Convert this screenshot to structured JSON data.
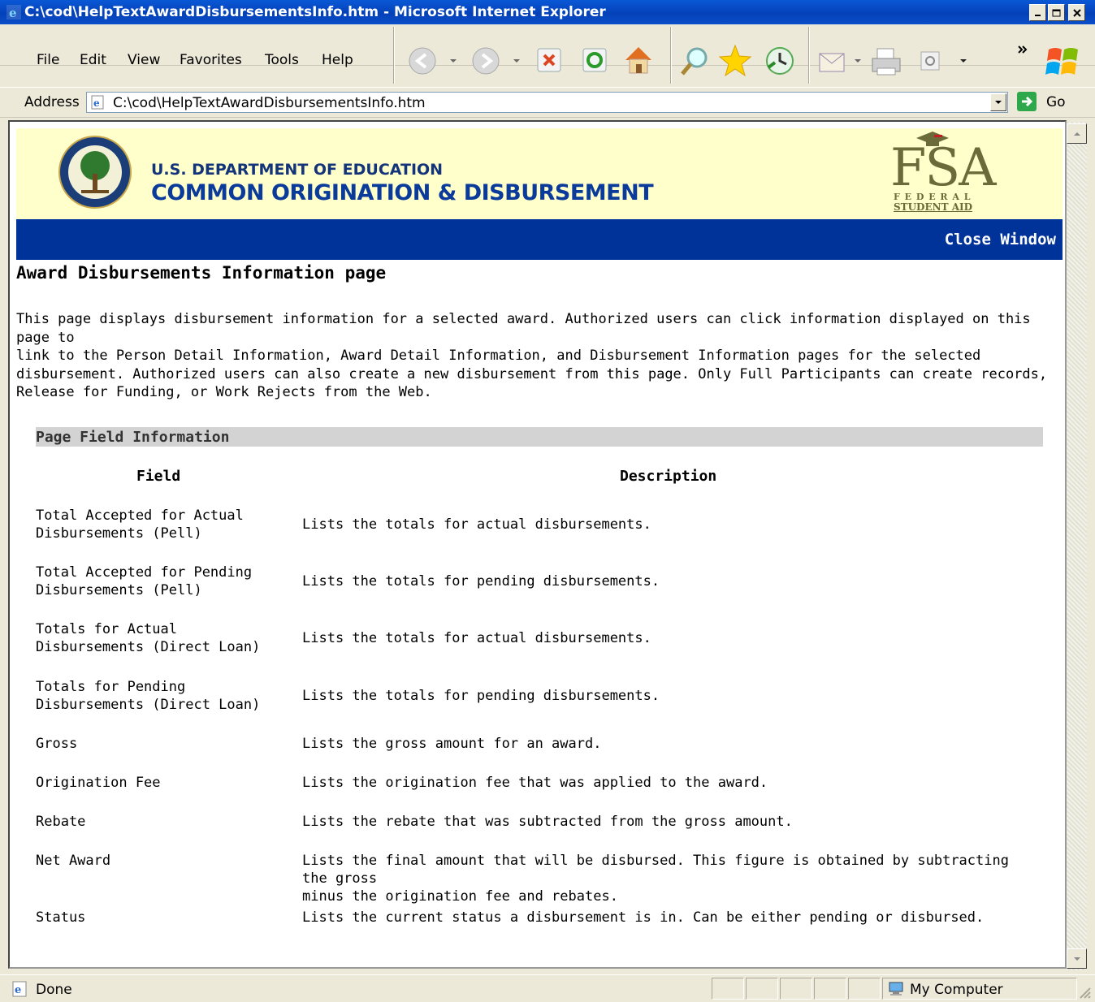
{
  "window": {
    "title": "C:\\cod\\HelpTextAwardDisbursementsInfo.htm - Microsoft Internet Explorer"
  },
  "menu": [
    "File",
    "Edit",
    "View",
    "Favorites",
    "Tools",
    "Help"
  ],
  "address": {
    "label": "Address",
    "url": "C:\\cod\\HelpTextAwardDisbursementsInfo.htm",
    "go_label": "Go"
  },
  "header": {
    "dept": "U.S. DEPARTMENT OF EDUCATION",
    "system": "COMMON ORIGINATION & DISBURSEMENT",
    "fsa_logo_text": "FSA",
    "fsa_logo_sub1": "F E D E R A L",
    "fsa_logo_sub2": "STUDENT AID"
  },
  "nav": {
    "close_window": "Close Window"
  },
  "page": {
    "title": "Award Disbursements Information page",
    "intro_lines": [
      "This page displays disbursement information for a selected award. Authorized users can click information displayed on this page to",
      "link to the Person Detail Information, Award Detail Information, and Disbursement Information pages for the selected",
      "disbursement. Authorized users can also create a new disbursement from this page. Only Full Participants can create records,",
      "Release for Funding, or Work Rejects from the Web."
    ],
    "section_title": "Page Field Information",
    "col_field": "Field",
    "col_description": "Description",
    "rows": [
      {
        "field": [
          "Total Accepted for Actual",
          "Disbursements (Pell)"
        ],
        "description": [
          "Lists the totals for actual disbursements."
        ]
      },
      {
        "field": [
          "Total Accepted for Pending",
          "Disbursements (Pell)"
        ],
        "description": [
          "Lists the totals for pending disbursements."
        ]
      },
      {
        "field": [
          "Totals for Actual",
          "Disbursements (Direct Loan)"
        ],
        "description": [
          "Lists the totals for actual disbursements."
        ]
      },
      {
        "field": [
          "Totals for Pending",
          "Disbursements (Direct Loan)"
        ],
        "description": [
          "Lists the totals for pending disbursements."
        ]
      },
      {
        "field": [
          "Gross"
        ],
        "description": [
          "Lists the gross amount for an award."
        ]
      },
      {
        "field": [
          "Origination Fee"
        ],
        "description": [
          "Lists the origination fee that was applied to the award."
        ]
      },
      {
        "field": [
          "Rebate"
        ],
        "description": [
          "Lists the rebate that was subtracted from the gross amount."
        ]
      },
      {
        "field": [
          "Net Award"
        ],
        "description": [
          "Lists the final amount that will be disbursed. This figure is obtained by subtracting the gross",
          "minus the origination fee and rebates."
        ]
      },
      {
        "field": [
          "Status"
        ],
        "description": [
          "Lists the current status a disbursement is in. Can be either pending or disbursed."
        ]
      }
    ]
  },
  "status": {
    "text": "Done",
    "zone": "My Computer"
  }
}
